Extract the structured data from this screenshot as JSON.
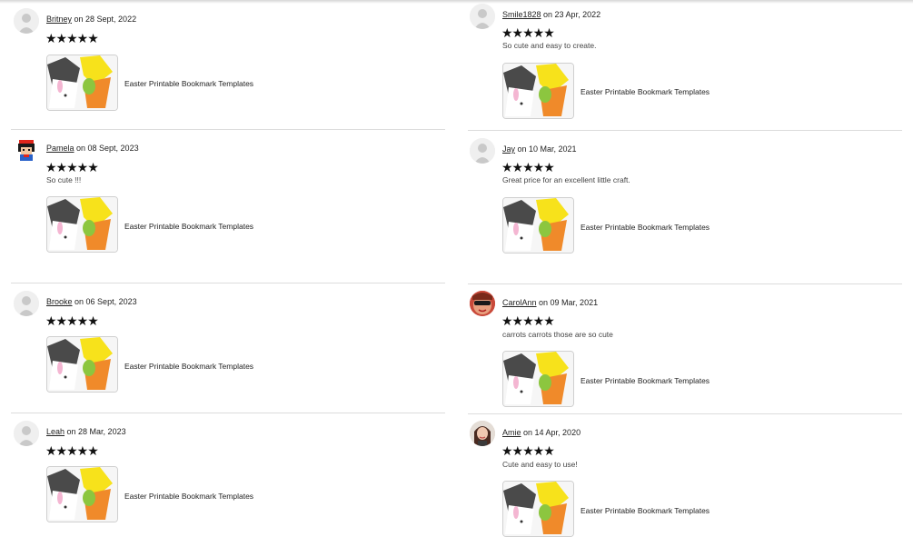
{
  "reviews_left": [
    {
      "user": "Britney",
      "date_text": " on 28 Sept, 2022",
      "stars": "★★★★★",
      "text": "",
      "product": "Easter Printable Bookmark Templates",
      "avatar": "default-avatar"
    },
    {
      "user": "Pamela",
      "date_text": " on 08 Sept, 2023",
      "stars": "★★★★★",
      "text": "So cute !!!",
      "product": "Easter Printable Bookmark Templates",
      "avatar": "pixel-avatar"
    },
    {
      "user": "Brooke",
      "date_text": " on 06 Sept, 2023",
      "stars": "★★★★★",
      "text": "",
      "product": "Easter Printable Bookmark Templates",
      "avatar": "default-avatar"
    },
    {
      "user": "Leah",
      "date_text": " on 28 Mar, 2023",
      "stars": "★★★★★",
      "text": "",
      "product": "Easter Printable Bookmark Templates",
      "avatar": "default-avatar"
    }
  ],
  "reviews_right": [
    {
      "user": "Smile1828",
      "date_text": " on 23 Apr, 2022",
      "stars": "★★★★★",
      "text": "So cute and easy to create.",
      "product": "Easter Printable Bookmark Templates",
      "avatar": "default-avatar"
    },
    {
      "user": "Jay",
      "date_text": " on 10 Mar, 2021",
      "stars": "★★★★★",
      "text": "Great price for an excellent little craft.",
      "product": "Easter Printable Bookmark Templates",
      "avatar": "default-avatar"
    },
    {
      "user": "CarolAnn",
      "date_text": " on 09 Mar, 2021",
      "stars": "★★★★★",
      "text": "carrots carrots those are so cute",
      "product": "Easter Printable Bookmark Templates",
      "avatar": "photo-avatar-sunglasses"
    },
    {
      "user": "Amie",
      "date_text": " on 14 Apr, 2020",
      "stars": "★★★★★",
      "text": "Cute and easy to use!",
      "product": "Easter Printable Bookmark Templates",
      "avatar": "photo-avatar-woman"
    }
  ],
  "colors": {
    "star": "#111111",
    "separator": "#dcdcdc",
    "link": "#222222"
  }
}
